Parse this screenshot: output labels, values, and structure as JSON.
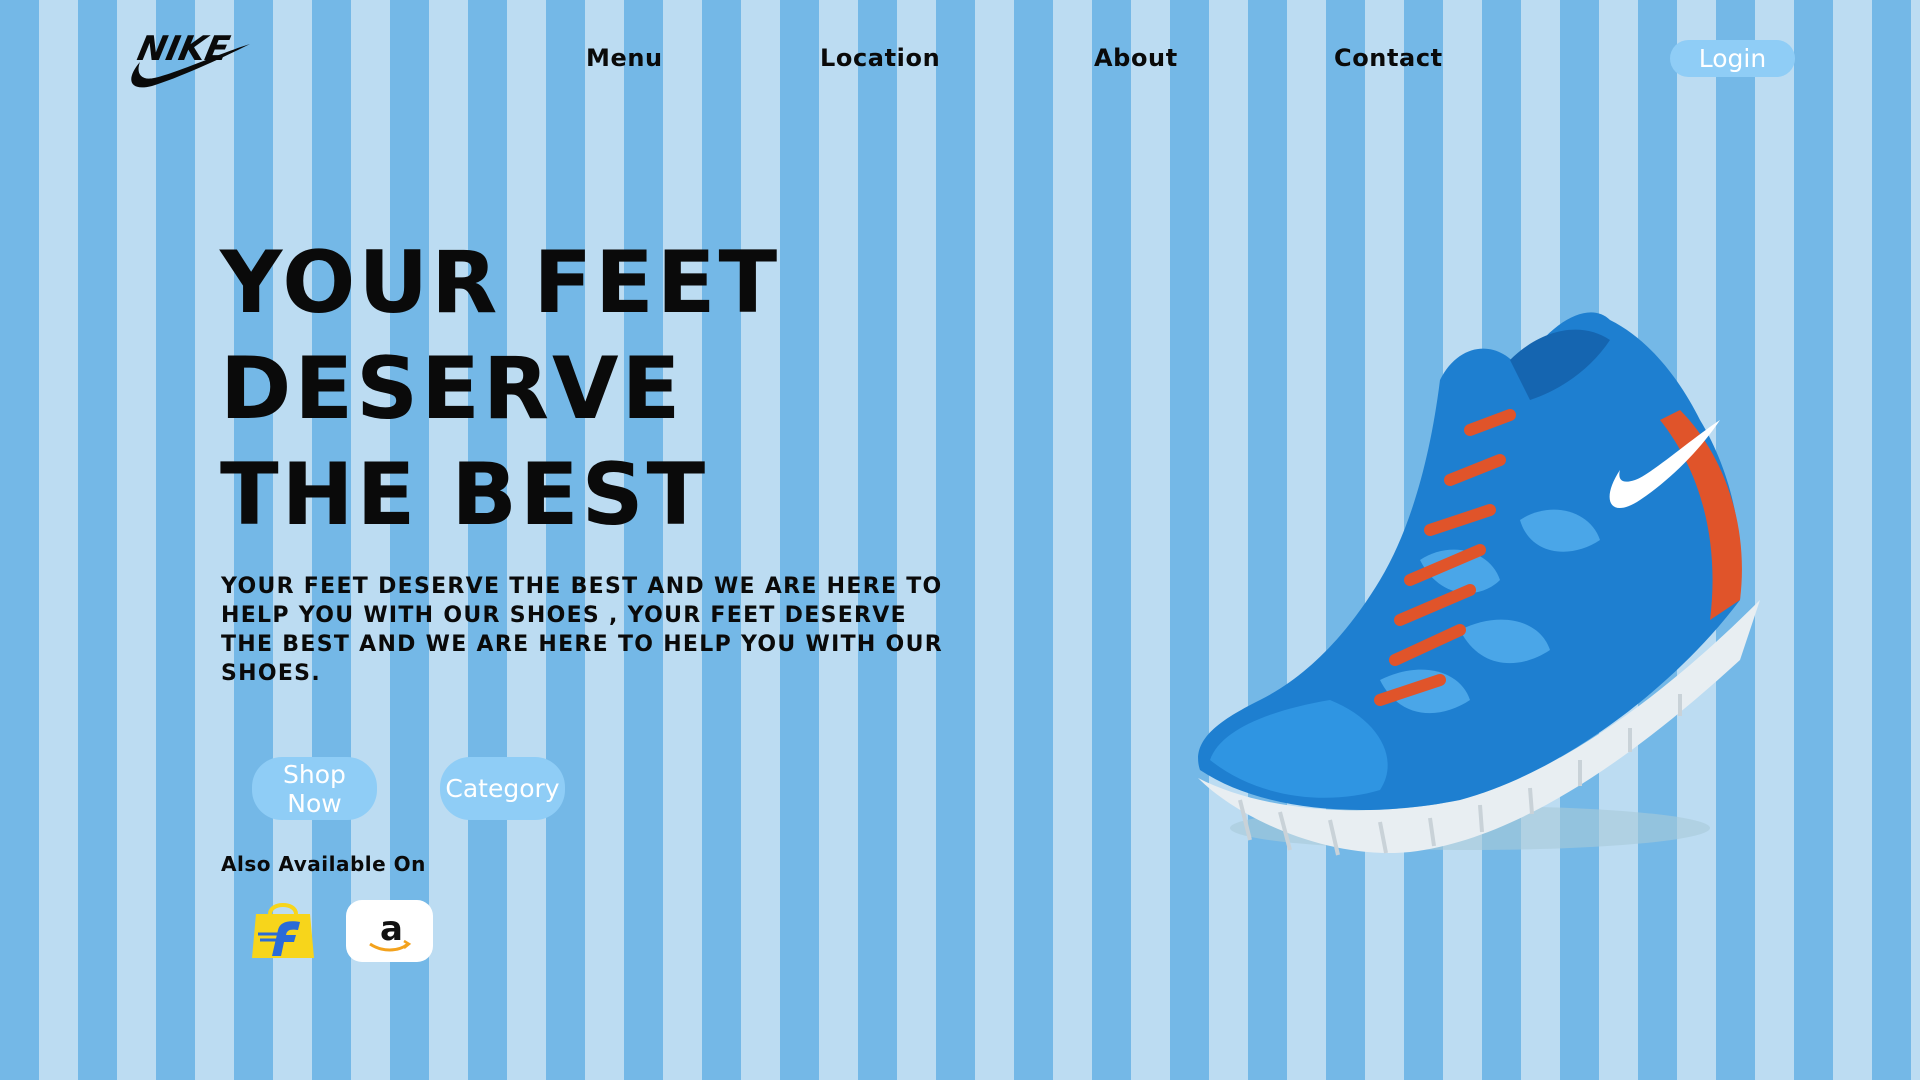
{
  "brand": {
    "logo_text": "NIKE"
  },
  "nav": {
    "items": [
      {
        "label": "Menu"
      },
      {
        "label": "Location"
      },
      {
        "label": "About"
      },
      {
        "label": "Contact"
      }
    ],
    "login_label": "Login"
  },
  "hero": {
    "headline_lines": [
      "YOUR FEET",
      "DESERVE",
      "THE BEST"
    ],
    "description": "YOUR FEET DESERVE THE BEST AND WE ARE HERE TO HELP YOU WITH OUR SHOES , YOUR FEET DESERVE THE BEST AND WE ARE HERE TO HELP YOU WITH OUR SHOES.",
    "shop_label": "Shop Now",
    "category_label": "Category",
    "available_label": "Also Available On"
  },
  "stores": [
    {
      "name": "Flipkart",
      "icon": "flipkart-icon"
    },
    {
      "name": "Amazon",
      "icon": "amazon-icon"
    }
  ],
  "colors": {
    "stripe_dark": "#74b8e7",
    "stripe_light": "#bcdcf2",
    "button_bg": "#8fcdf6",
    "button_text": "#ffffff",
    "text": "#0a0a0a",
    "shoe_blue": "#1e7fd0",
    "lace_orange": "#e0542a"
  },
  "images": {
    "shoe": "blue running shoe with orange laces"
  }
}
